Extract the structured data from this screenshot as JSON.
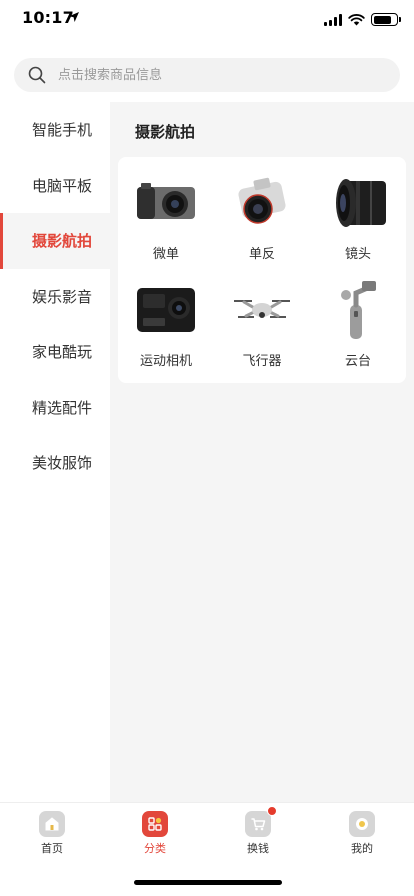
{
  "status": {
    "time": "10:17",
    "battery_level": 0.8
  },
  "search": {
    "placeholder": "点击搜索商品信息"
  },
  "sidebar": {
    "items": [
      {
        "label": "智能手机",
        "active": false
      },
      {
        "label": "电脑平板",
        "active": false
      },
      {
        "label": "摄影航拍",
        "active": true
      },
      {
        "label": "娱乐影音",
        "active": false
      },
      {
        "label": "家电酷玩",
        "active": false
      },
      {
        "label": "精选配件",
        "active": false
      },
      {
        "label": "美妆服饰",
        "active": false
      }
    ]
  },
  "main": {
    "title": "摄影航拍",
    "products": [
      {
        "label": "微单",
        "icon": "mirrorless-camera-icon"
      },
      {
        "label": "单反",
        "icon": "dslr-camera-icon"
      },
      {
        "label": "镜头",
        "icon": "camera-lens-icon"
      },
      {
        "label": "运动相机",
        "icon": "action-camera-icon"
      },
      {
        "label": "飞行器",
        "icon": "drone-icon"
      },
      {
        "label": "云台",
        "icon": "gimbal-icon"
      }
    ]
  },
  "bottom_nav": {
    "items": [
      {
        "label": "首页",
        "icon": "home-icon",
        "active": false
      },
      {
        "label": "分类",
        "icon": "category-icon",
        "active": true
      },
      {
        "label": "换钱",
        "icon": "cart-icon",
        "active": false,
        "badge": true
      },
      {
        "label": "我的",
        "icon": "profile-icon",
        "active": false
      }
    ]
  },
  "colors": {
    "accent": "#e2473b",
    "background": "#f5f5f5"
  }
}
